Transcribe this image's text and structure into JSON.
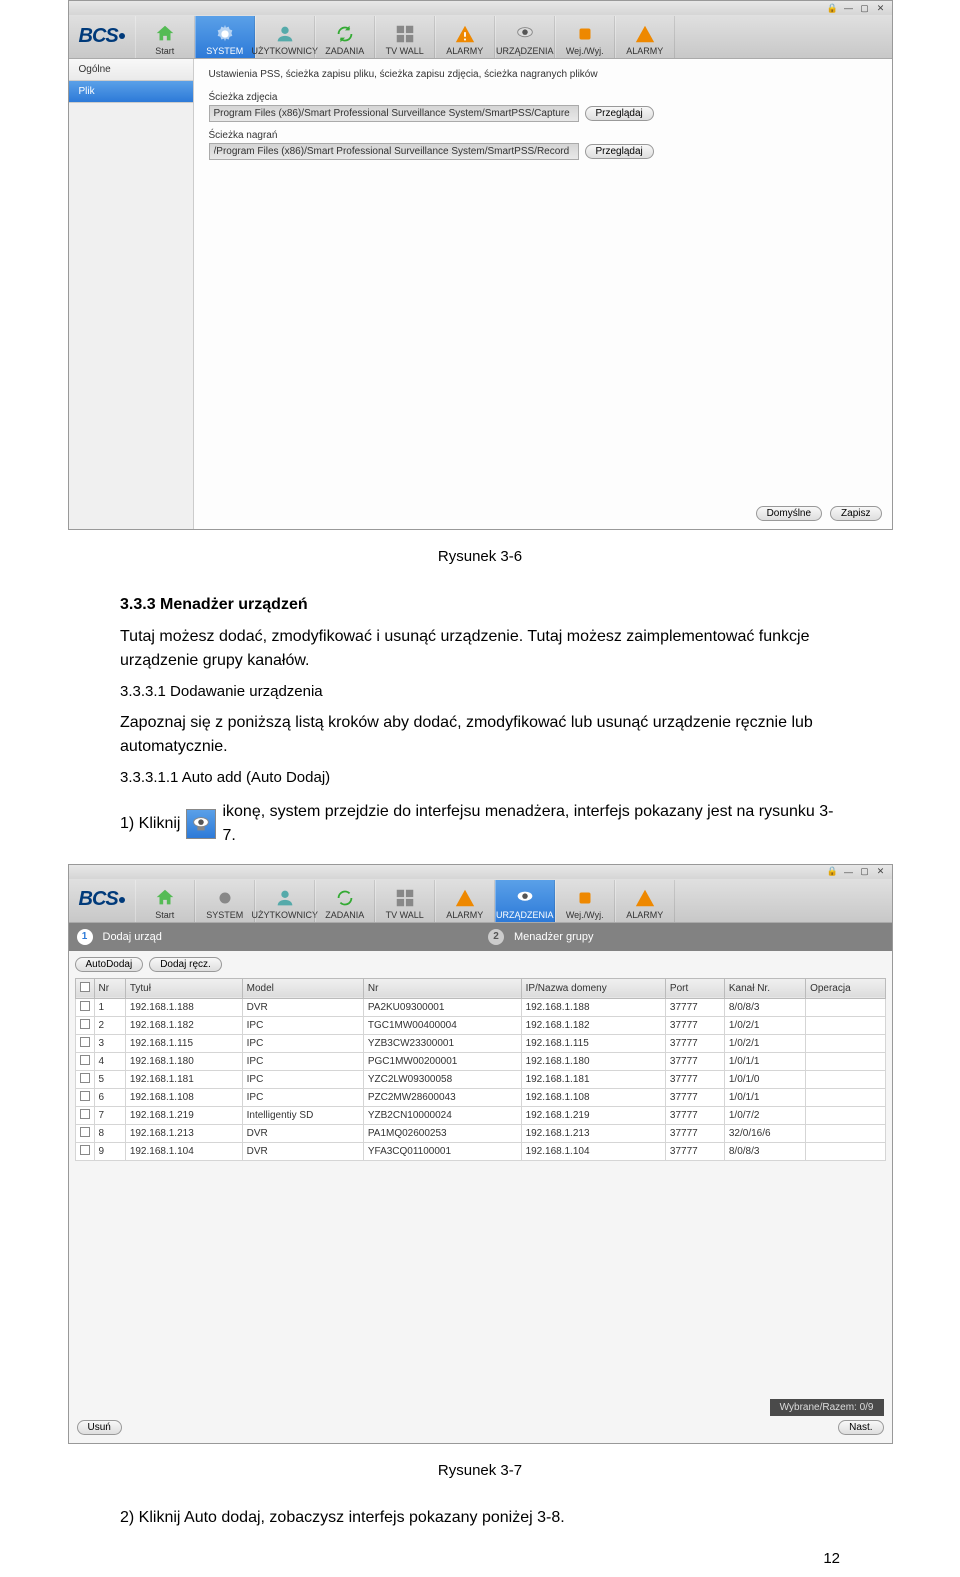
{
  "nav": {
    "brand": "BCS",
    "items": [
      "Start",
      "SYSTEM",
      "UŻYTKOWNICY",
      "ZADANIA",
      "TV WALL",
      "ALARMY",
      "URZĄDZENIA",
      "Wej./Wyj.",
      "ALARMY"
    ]
  },
  "win1": {
    "side": {
      "general": "Ogólne",
      "file": "Plik"
    },
    "desc": "Ustawienia PSS, ścieżka zapisu pliku, ścieżka zapisu zdjęcia, ścieżka nagranych plików",
    "photo_label": "Ścieżka zdjęcia",
    "photo_path": "Program Files (x86)/Smart Professional Surveillance System/SmartPSS/Capture",
    "rec_label": "Ścieżka nagrań",
    "rec_path": "/Program Files (x86)/Smart Professional Surveillance System/SmartPSS/Record",
    "browse": "Przeglądaj",
    "default": "Domyślne",
    "save": "Zapisz"
  },
  "doc": {
    "cap1": "Rysunek 3-6",
    "h3": "3.3.3  Menadżer urządzeń",
    "p1": "Tutaj możesz dodać, zmodyfikować i usunąć urządzenie. Tutaj możesz zaimplementować funkcje urządzenie grupy kanałów.",
    "h4a": "3.3.3.1  Dodawanie urządzenia",
    "p2": "Zapoznaj się z poniższą listą kroków aby dodać, zmodyfikować lub usunąć urządzenie ręcznie lub automatycznie.",
    "h4b": "3.3.3.1.1   Auto add  (Auto Dodaj)",
    "l1a": "1)   Kliknij",
    "l1b": "ikonę, system przejdzie do interfejsu menadżera, interfejs pokazany jest na rysunku 3-7.",
    "cap2": "Rysunek 3-7",
    "l2": "2)   Kliknij Auto dodaj, zobaczysz interfejs pokazany poniżej 3-8.",
    "pagenum": "12"
  },
  "win2": {
    "step1": "Dodaj urząd",
    "step2": "Menadżer grupy",
    "auto": "AutoDodaj",
    "manual": "Dodaj ręcz.",
    "delete": "Usuń",
    "selected": "Wybrane/Razem:  0/9",
    "next": "Nast.",
    "cols": [
      "Nr",
      "Tytuł",
      "Model",
      "Nr",
      "IP/Nazwa domeny",
      "Port",
      "Kanał Nr.",
      "Operacja"
    ],
    "rows": [
      {
        "n": "1",
        "t": "192.168.1.188",
        "m": "DVR",
        "s": "PA2KU09300001",
        "ip": "192.168.1.188",
        "p": "37777",
        "c": "8/0/8/3"
      },
      {
        "n": "2",
        "t": "192.168.1.182",
        "m": "IPC",
        "s": "TGC1MW00400004",
        "ip": "192.168.1.182",
        "p": "37777",
        "c": "1/0/2/1"
      },
      {
        "n": "3",
        "t": "192.168.1.115",
        "m": "IPC",
        "s": "YZB3CW23300001",
        "ip": "192.168.1.115",
        "p": "37777",
        "c": "1/0/2/1"
      },
      {
        "n": "4",
        "t": "192.168.1.180",
        "m": "IPC",
        "s": "PGC1MW00200001",
        "ip": "192.168.1.180",
        "p": "37777",
        "c": "1/0/1/1"
      },
      {
        "n": "5",
        "t": "192.168.1.181",
        "m": "IPC",
        "s": "YZC2LW09300058",
        "ip": "192.168.1.181",
        "p": "37777",
        "c": "1/0/1/0"
      },
      {
        "n": "6",
        "t": "192.168.1.108",
        "m": "IPC",
        "s": "PZC2MW28600043",
        "ip": "192.168.1.108",
        "p": "37777",
        "c": "1/0/1/1"
      },
      {
        "n": "7",
        "t": "192.168.1.219",
        "m": "Intelligentiy SD",
        "s": "YZB2CN10000024",
        "ip": "192.168.1.219",
        "p": "37777",
        "c": "1/0/7/2"
      },
      {
        "n": "8",
        "t": "192.168.1.213",
        "m": "DVR",
        "s": "PA1MQ02600253",
        "ip": "192.168.1.213",
        "p": "37777",
        "c": "32/0/16/6"
      },
      {
        "n": "9",
        "t": "192.168.1.104",
        "m": "DVR",
        "s": "YFA3CQ01100001",
        "ip": "192.168.1.104",
        "p": "37777",
        "c": "8/0/8/3"
      }
    ]
  }
}
